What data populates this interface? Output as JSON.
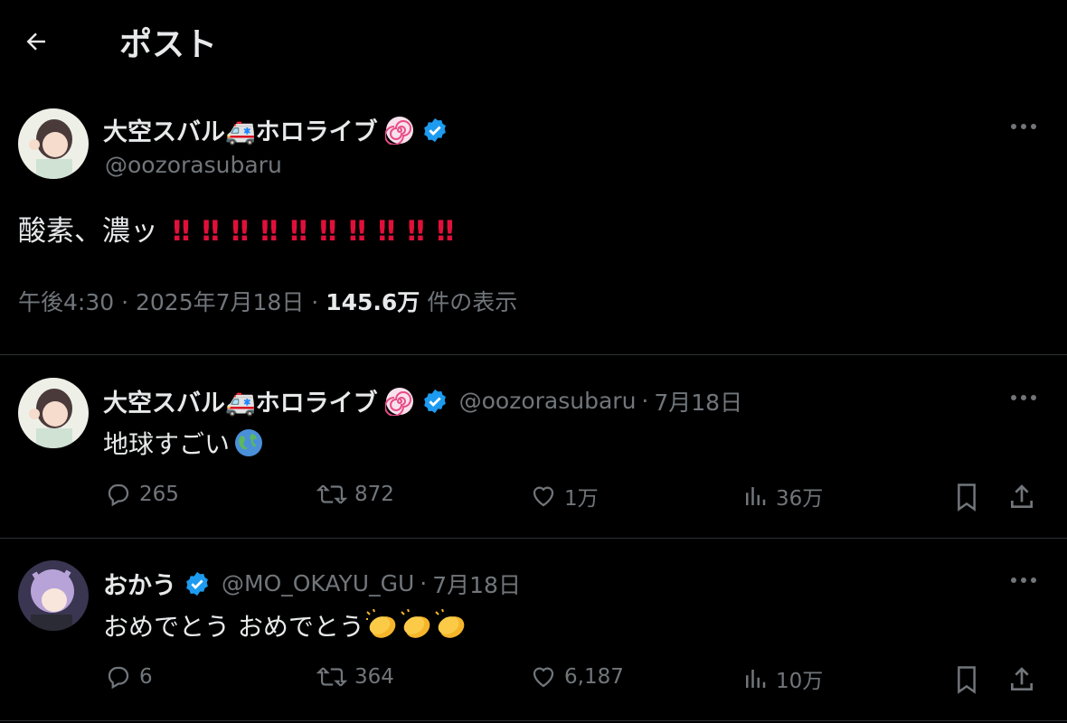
{
  "header": {
    "title": "ポスト"
  },
  "post": {
    "display_name": "大空スバル🚑ホロライブ",
    "handle": "@oozorasubaru",
    "text_prefix": "酸素、濃ッ",
    "exclaims": [
      "‼",
      "‼",
      "‼",
      "‼",
      "‼",
      "‼",
      "‼",
      "‼",
      "‼",
      "‼"
    ],
    "time": "午後4:30",
    "date": "2025年7月18日",
    "views_count": "145.6万",
    "views_label": "件の表示",
    "separator": "·"
  },
  "replies": [
    {
      "display_name": "大空スバル🚑ホロライブ",
      "handle": "@oozorasubaru",
      "date": "7月18日",
      "text": "地球すごい",
      "reply_count": "265",
      "repost_count": "872",
      "like_count": "1万",
      "view_count": "36万"
    },
    {
      "display_name": "おかう",
      "handle": "@MO_OKAYU_GU",
      "date": "7月18日",
      "text": "おめでとう おめでとう",
      "reply_count": "6",
      "repost_count": "364",
      "like_count": "6,187",
      "view_count": "10万"
    }
  ],
  "colors": {
    "background": "#000000",
    "text": "#e7e9ea",
    "muted": "#71767b",
    "verified": "#1d9bf0",
    "exclaim": "#e0103a",
    "divider": "#2f3336"
  },
  "icons": [
    "back-arrow-icon",
    "verified-icon",
    "spiral-icon",
    "more-icon",
    "reply-icon",
    "repost-icon",
    "like-icon",
    "views-icon",
    "bookmark-icon",
    "share-icon",
    "globe-emoji-icon",
    "clap-emoji-icon"
  ]
}
